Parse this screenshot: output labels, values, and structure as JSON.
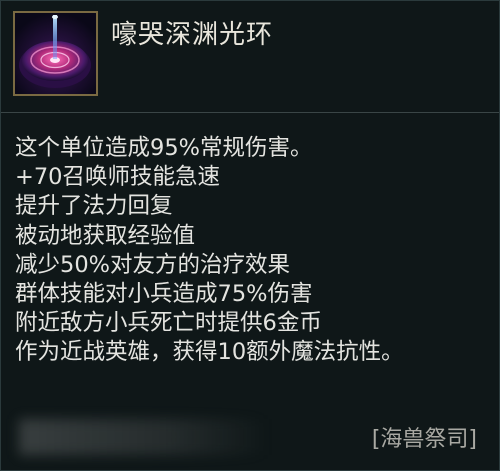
{
  "item": {
    "icon": "wailing-abyss-aura-icon",
    "name": "嚎哭深渊光环"
  },
  "stats": [
    "这个单位造成95%常规伤害。",
    "+70召唤师技能急速",
    "提升了法力回复",
    "被动地获取经验值",
    "减少50%对友方的治疗效果",
    "群体技能对小兵造成75%伤害",
    "附近敌方小兵死亡时提供6金币",
    "作为近战英雄，获得10额外魔法抗性。"
  ],
  "footer": {
    "tag": "[海兽祭司]"
  },
  "colors": {
    "background": "#0f1718",
    "icon_border": "#7a6a42",
    "text": "#e4e4e0",
    "tag_text": "#a9a9a3"
  }
}
